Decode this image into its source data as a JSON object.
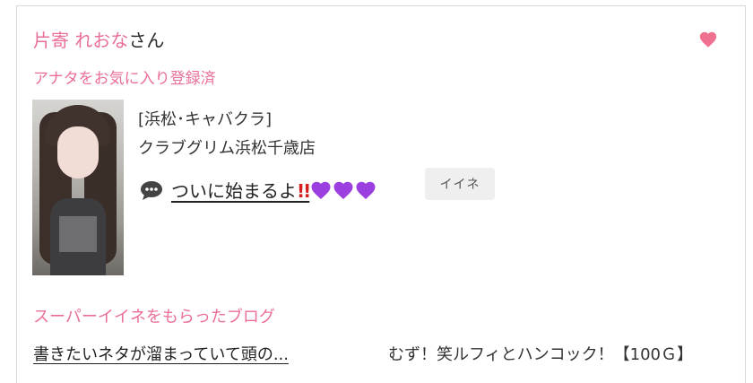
{
  "user": {
    "name": "片寄 れおな",
    "name_suffix": "さん",
    "favorite_note": "アナタをお気に入り登録済"
  },
  "post": {
    "category": "[浜松･キャバクラ]",
    "shop": "クラブグリム浜松千歳店",
    "blog_title": "ついに始まるよ",
    "blog_marks": "!!",
    "like_button": "イイネ"
  },
  "super_like": {
    "heading": "スーパーイイネをもらったブログ",
    "blog_title": "書きたいネタが溜まっていて頭の...",
    "blog_info": "むず！笑ルフィとハンコック！【100Ｇ】"
  },
  "colors": {
    "accent_pink": "#ea6f97",
    "heart": "#f0708f",
    "purple_heart": "#9b3fe0"
  },
  "icons": {
    "favorite": "heart-icon",
    "comment": "speech-bubble-icon"
  }
}
